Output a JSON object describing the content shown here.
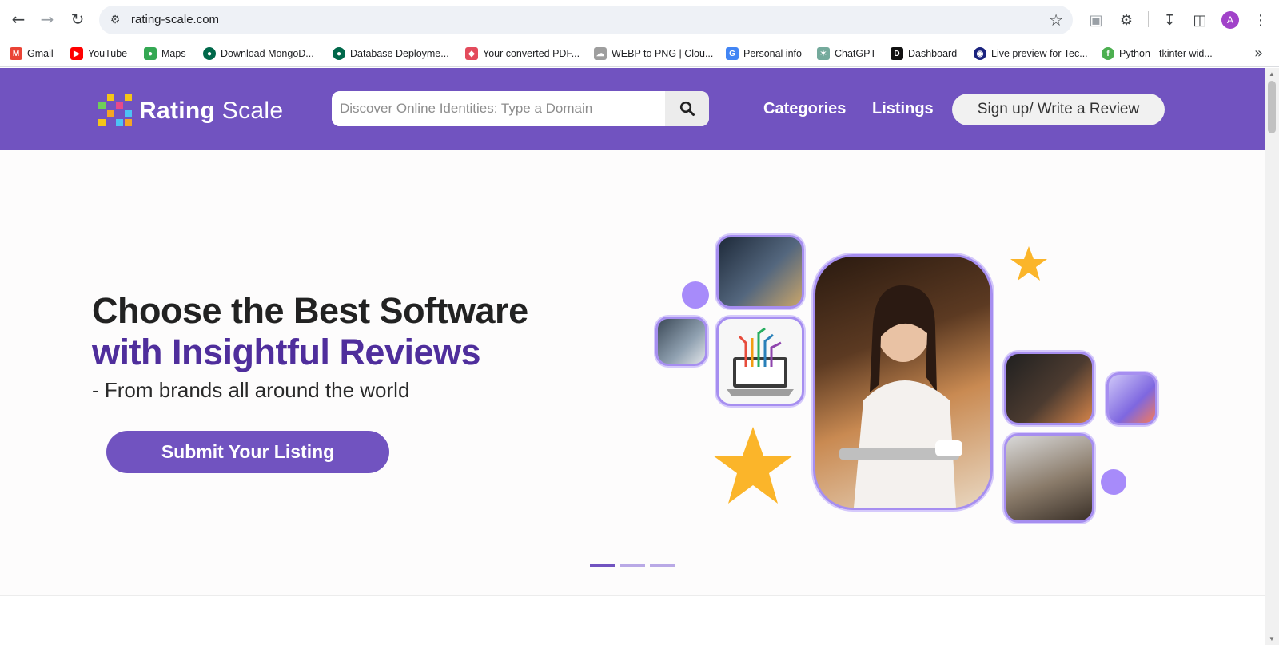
{
  "browser": {
    "url": "rating-scale.com",
    "avatar_letter": "A",
    "bookmarks": [
      {
        "label": "Gmail",
        "icon": "gmail-icon",
        "color": "#ea4335"
      },
      {
        "label": "YouTube",
        "icon": "youtube-icon",
        "color": "#ff0000"
      },
      {
        "label": "Maps",
        "icon": "maps-icon",
        "color": "#34a853"
      },
      {
        "label": "Download MongoD...",
        "icon": "mongodb-icon",
        "color": "#00684a"
      },
      {
        "label": "Database Deployme...",
        "icon": "mongodb-icon",
        "color": "#00684a"
      },
      {
        "label": "Your converted PDF...",
        "icon": "pdf-converter-icon",
        "color": "#e34b5c"
      },
      {
        "label": "WEBP to PNG | Clou...",
        "icon": "cloud-icon",
        "color": "#777777"
      },
      {
        "label": "Personal info",
        "icon": "google-icon",
        "color": "#4285f4"
      },
      {
        "label": "ChatGPT",
        "icon": "chatgpt-icon",
        "color": "#74aa9c"
      },
      {
        "label": "Dashboard",
        "icon": "dashboard-icon",
        "color": "#111111"
      },
      {
        "label": "Live preview for Tec...",
        "icon": "live-preview-icon",
        "color": "#1a237e"
      },
      {
        "label": "Python - tkinter wid...",
        "icon": "python-icon",
        "color": "#4caf50"
      }
    ]
  },
  "site": {
    "logo_word1": "Rating",
    "logo_word2": "Scale",
    "search_placeholder": "Discover Online Identities: Type a Domain",
    "nav": {
      "categories": "Categories",
      "listings": "Listings",
      "signup": "Sign up/ Write a Review"
    },
    "hero": {
      "title_line1": "Choose the Best Software",
      "title_line2": "with Insightful Reviews",
      "subtitle": "- From brands all around the world",
      "cta": "Submit Your Listing"
    },
    "slides": {
      "total": 3,
      "active": 1
    }
  },
  "colors": {
    "brand": "#7153c0",
    "brand_dark": "#4f2e9c",
    "accent_star": "#fbb52a",
    "dot": "#a78bfa"
  }
}
